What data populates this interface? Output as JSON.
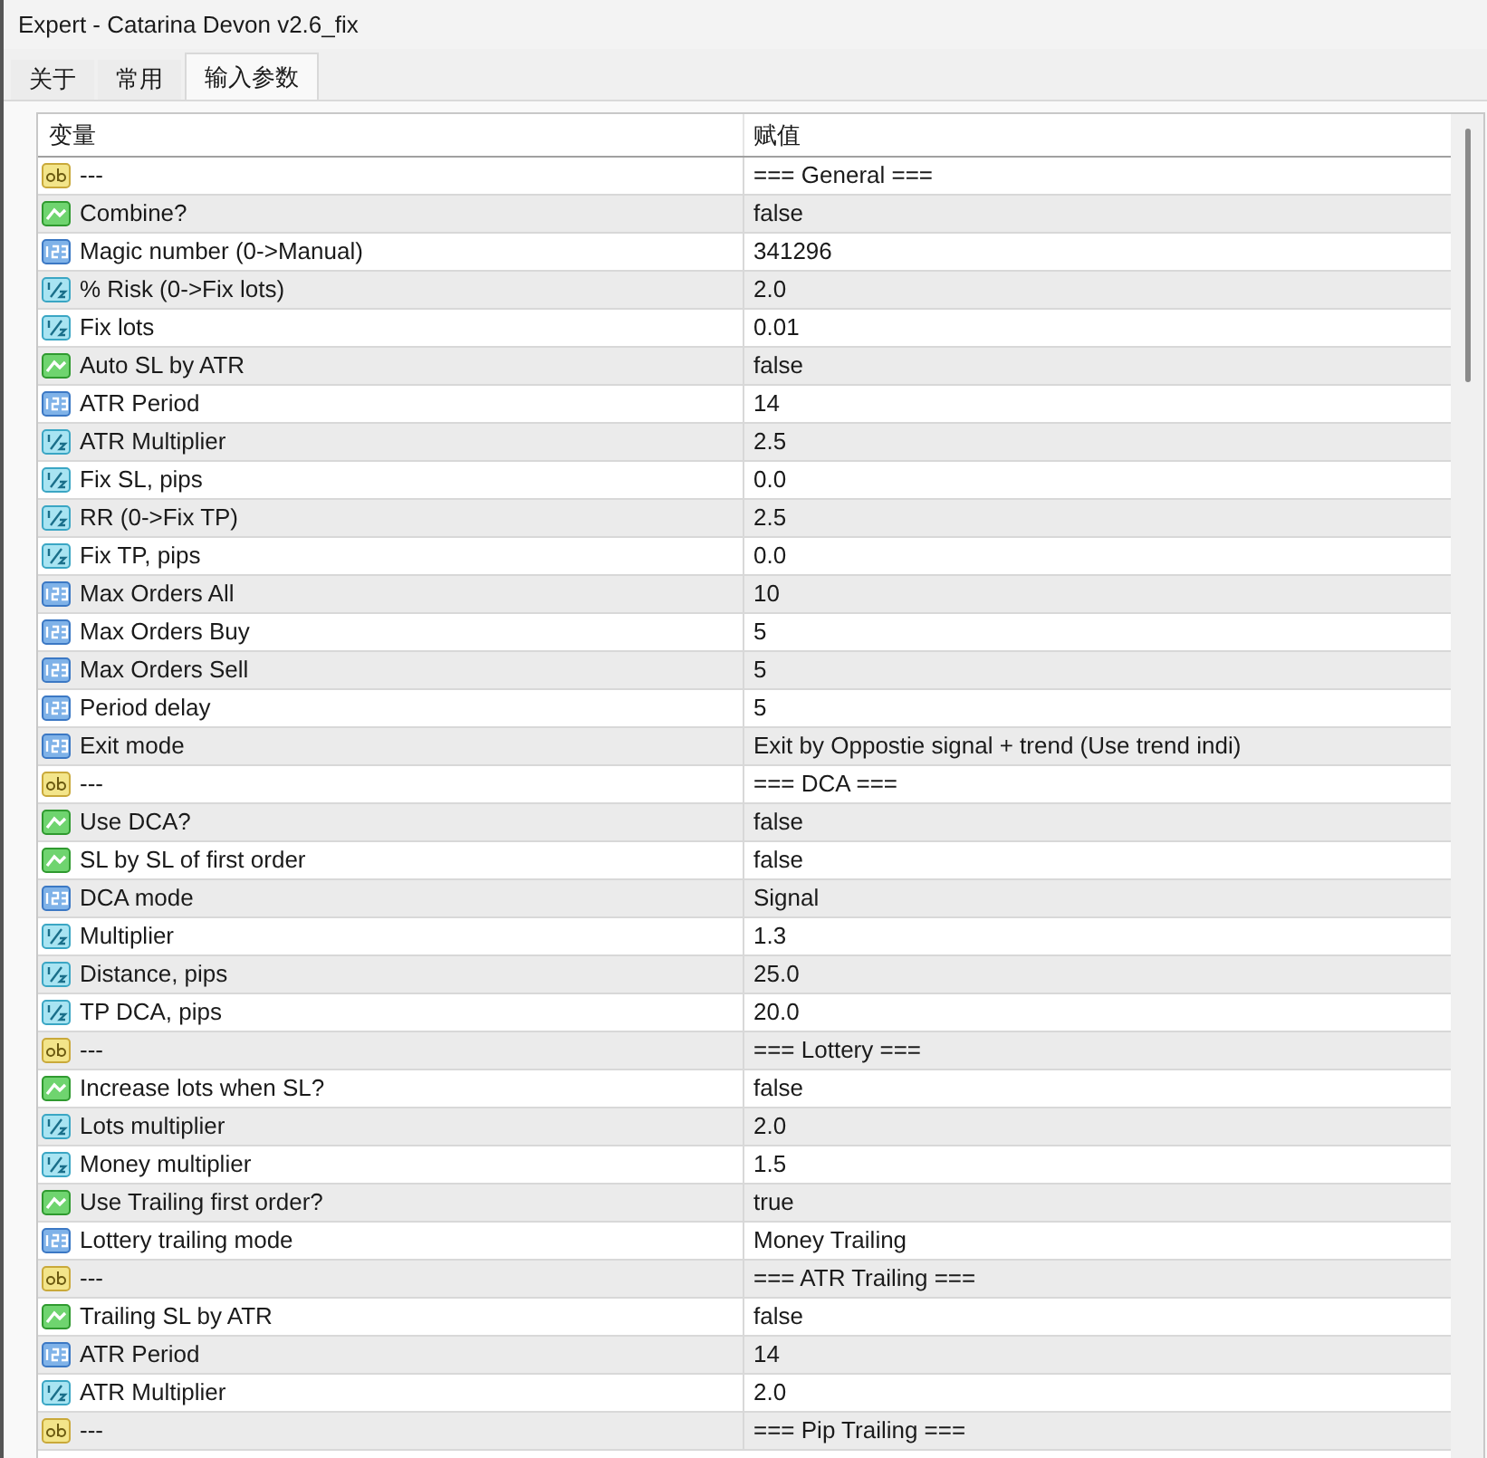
{
  "window": {
    "title": "Expert - Catarina Devon v2.6_fix"
  },
  "tabs": [
    {
      "label": "关于",
      "selected": false
    },
    {
      "label": "常用",
      "selected": false
    },
    {
      "label": "输入参数",
      "selected": true
    }
  ],
  "table": {
    "columns": [
      "变量",
      "赋值"
    ],
    "rows": [
      {
        "kind": "string",
        "name": "---",
        "value": "=== General ==="
      },
      {
        "kind": "bool",
        "name": "Combine?",
        "value": "false"
      },
      {
        "kind": "int",
        "name": "Magic number (0->Manual)",
        "value": "341296"
      },
      {
        "kind": "double",
        "name": "% Risk (0->Fix lots)",
        "value": "2.0"
      },
      {
        "kind": "double",
        "name": "Fix lots",
        "value": "0.01"
      },
      {
        "kind": "bool",
        "name": "Auto SL by ATR",
        "value": "false"
      },
      {
        "kind": "int",
        "name": "ATR Period",
        "value": "14"
      },
      {
        "kind": "double",
        "name": "ATR Multiplier",
        "value": "2.5"
      },
      {
        "kind": "double",
        "name": "Fix SL, pips",
        "value": "0.0"
      },
      {
        "kind": "double",
        "name": "RR (0->Fix TP)",
        "value": "2.5"
      },
      {
        "kind": "double",
        "name": "Fix TP, pips",
        "value": "0.0"
      },
      {
        "kind": "int",
        "name": "Max Orders All",
        "value": "10"
      },
      {
        "kind": "int",
        "name": "Max Orders Buy",
        "value": "5"
      },
      {
        "kind": "int",
        "name": "Max Orders Sell",
        "value": "5"
      },
      {
        "kind": "int",
        "name": "Period delay",
        "value": "5"
      },
      {
        "kind": "int",
        "name": "Exit mode",
        "value": "Exit by Oppostie signal + trend (Use trend indi)"
      },
      {
        "kind": "string",
        "name": "---",
        "value": "=== DCA ==="
      },
      {
        "kind": "bool",
        "name": "Use DCA?",
        "value": "false"
      },
      {
        "kind": "bool",
        "name": "SL by SL of first order",
        "value": "false"
      },
      {
        "kind": "int",
        "name": "DCA mode",
        "value": "Signal"
      },
      {
        "kind": "double",
        "name": "Multiplier",
        "value": "1.3"
      },
      {
        "kind": "double",
        "name": "Distance, pips",
        "value": "25.0"
      },
      {
        "kind": "double",
        "name": "TP DCA, pips",
        "value": "20.0"
      },
      {
        "kind": "string",
        "name": "---",
        "value": "=== Lottery ==="
      },
      {
        "kind": "bool",
        "name": "Increase lots when SL?",
        "value": "false"
      },
      {
        "kind": "double",
        "name": "Lots multiplier",
        "value": "2.0"
      },
      {
        "kind": "double",
        "name": "Money multiplier",
        "value": "1.5"
      },
      {
        "kind": "bool",
        "name": "Use Trailing first order?",
        "value": "true"
      },
      {
        "kind": "int",
        "name": "Lottery trailing mode",
        "value": "Money Trailing"
      },
      {
        "kind": "string",
        "name": "---",
        "value": "=== ATR Trailing ==="
      },
      {
        "kind": "bool",
        "name": "Trailing SL by ATR",
        "value": "false"
      },
      {
        "kind": "int",
        "name": "ATR Period",
        "value": "14"
      },
      {
        "kind": "double",
        "name": "ATR Multiplier",
        "value": "2.0"
      },
      {
        "kind": "string",
        "name": "---",
        "value": "=== Pip Trailing ==="
      }
    ]
  }
}
